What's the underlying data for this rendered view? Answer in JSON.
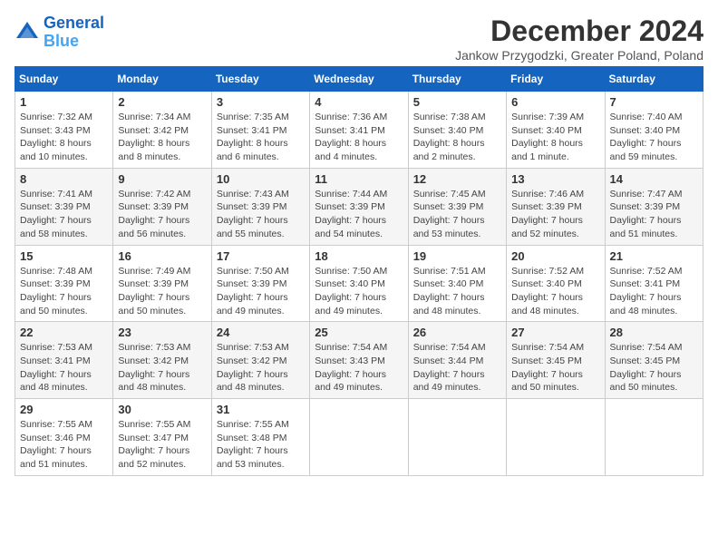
{
  "header": {
    "logo_line1": "General",
    "logo_line2": "Blue",
    "month": "December 2024",
    "location": "Jankow Przygodzki, Greater Poland, Poland"
  },
  "weekdays": [
    "Sunday",
    "Monday",
    "Tuesday",
    "Wednesday",
    "Thursday",
    "Friday",
    "Saturday"
  ],
  "weeks": [
    [
      {
        "day": "1",
        "sunrise": "7:32 AM",
        "sunset": "3:43 PM",
        "daylight": "8 hours and 10 minutes."
      },
      {
        "day": "2",
        "sunrise": "7:34 AM",
        "sunset": "3:42 PM",
        "daylight": "8 hours and 8 minutes."
      },
      {
        "day": "3",
        "sunrise": "7:35 AM",
        "sunset": "3:41 PM",
        "daylight": "8 hours and 6 minutes."
      },
      {
        "day": "4",
        "sunrise": "7:36 AM",
        "sunset": "3:41 PM",
        "daylight": "8 hours and 4 minutes."
      },
      {
        "day": "5",
        "sunrise": "7:38 AM",
        "sunset": "3:40 PM",
        "daylight": "8 hours and 2 minutes."
      },
      {
        "day": "6",
        "sunrise": "7:39 AM",
        "sunset": "3:40 PM",
        "daylight": "8 hours and 1 minute."
      },
      {
        "day": "7",
        "sunrise": "7:40 AM",
        "sunset": "3:40 PM",
        "daylight": "7 hours and 59 minutes."
      }
    ],
    [
      {
        "day": "8",
        "sunrise": "7:41 AM",
        "sunset": "3:39 PM",
        "daylight": "7 hours and 58 minutes."
      },
      {
        "day": "9",
        "sunrise": "7:42 AM",
        "sunset": "3:39 PM",
        "daylight": "7 hours and 56 minutes."
      },
      {
        "day": "10",
        "sunrise": "7:43 AM",
        "sunset": "3:39 PM",
        "daylight": "7 hours and 55 minutes."
      },
      {
        "day": "11",
        "sunrise": "7:44 AM",
        "sunset": "3:39 PM",
        "daylight": "7 hours and 54 minutes."
      },
      {
        "day": "12",
        "sunrise": "7:45 AM",
        "sunset": "3:39 PM",
        "daylight": "7 hours and 53 minutes."
      },
      {
        "day": "13",
        "sunrise": "7:46 AM",
        "sunset": "3:39 PM",
        "daylight": "7 hours and 52 minutes."
      },
      {
        "day": "14",
        "sunrise": "7:47 AM",
        "sunset": "3:39 PM",
        "daylight": "7 hours and 51 minutes."
      }
    ],
    [
      {
        "day": "15",
        "sunrise": "7:48 AM",
        "sunset": "3:39 PM",
        "daylight": "7 hours and 50 minutes."
      },
      {
        "day": "16",
        "sunrise": "7:49 AM",
        "sunset": "3:39 PM",
        "daylight": "7 hours and 50 minutes."
      },
      {
        "day": "17",
        "sunrise": "7:50 AM",
        "sunset": "3:39 PM",
        "daylight": "7 hours and 49 minutes."
      },
      {
        "day": "18",
        "sunrise": "7:50 AM",
        "sunset": "3:40 PM",
        "daylight": "7 hours and 49 minutes."
      },
      {
        "day": "19",
        "sunrise": "7:51 AM",
        "sunset": "3:40 PM",
        "daylight": "7 hours and 48 minutes."
      },
      {
        "day": "20",
        "sunrise": "7:52 AM",
        "sunset": "3:40 PM",
        "daylight": "7 hours and 48 minutes."
      },
      {
        "day": "21",
        "sunrise": "7:52 AM",
        "sunset": "3:41 PM",
        "daylight": "7 hours and 48 minutes."
      }
    ],
    [
      {
        "day": "22",
        "sunrise": "7:53 AM",
        "sunset": "3:41 PM",
        "daylight": "7 hours and 48 minutes."
      },
      {
        "day": "23",
        "sunrise": "7:53 AM",
        "sunset": "3:42 PM",
        "daylight": "7 hours and 48 minutes."
      },
      {
        "day": "24",
        "sunrise": "7:53 AM",
        "sunset": "3:42 PM",
        "daylight": "7 hours and 48 minutes."
      },
      {
        "day": "25",
        "sunrise": "7:54 AM",
        "sunset": "3:43 PM",
        "daylight": "7 hours and 49 minutes."
      },
      {
        "day": "26",
        "sunrise": "7:54 AM",
        "sunset": "3:44 PM",
        "daylight": "7 hours and 49 minutes."
      },
      {
        "day": "27",
        "sunrise": "7:54 AM",
        "sunset": "3:45 PM",
        "daylight": "7 hours and 50 minutes."
      },
      {
        "day": "28",
        "sunrise": "7:54 AM",
        "sunset": "3:45 PM",
        "daylight": "7 hours and 50 minutes."
      }
    ],
    [
      {
        "day": "29",
        "sunrise": "7:55 AM",
        "sunset": "3:46 PM",
        "daylight": "7 hours and 51 minutes."
      },
      {
        "day": "30",
        "sunrise": "7:55 AM",
        "sunset": "3:47 PM",
        "daylight": "7 hours and 52 minutes."
      },
      {
        "day": "31",
        "sunrise": "7:55 AM",
        "sunset": "3:48 PM",
        "daylight": "7 hours and 53 minutes."
      },
      null,
      null,
      null,
      null
    ]
  ],
  "labels": {
    "sunrise": "Sunrise:",
    "sunset": "Sunset:",
    "daylight": "Daylight:"
  }
}
